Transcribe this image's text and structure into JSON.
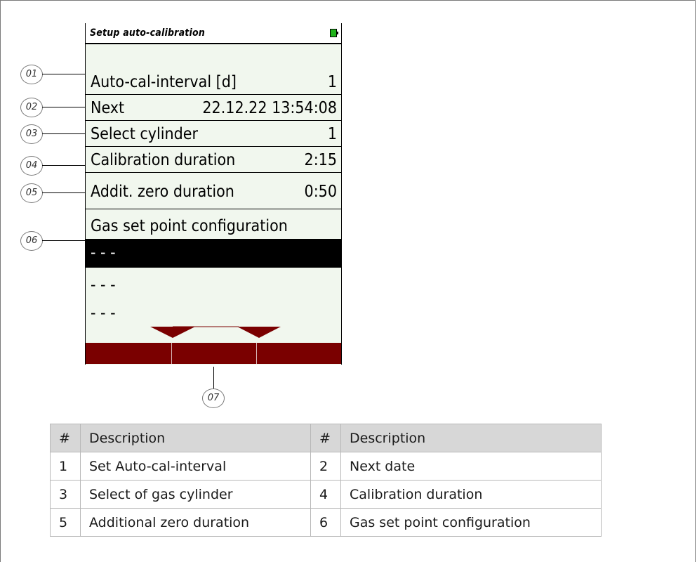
{
  "screen": {
    "title": "Setup auto-calibration",
    "rows": [
      {
        "label": "Auto-cal-interval [d]",
        "value": "1"
      },
      {
        "label": "Next",
        "value": "22.12.22 13:54:08"
      },
      {
        "label": "Select cylinder",
        "value": "1"
      },
      {
        "label": "Calibration duration",
        "value": "2:15"
      },
      {
        "label": "Addit. zero duration",
        "value": "0:50"
      }
    ],
    "gas_header": "Gas set point configuration",
    "gas_items": [
      "- - -",
      "- - -",
      "- - -"
    ],
    "colors": {
      "softkey_bar": "#7a0000",
      "battery": "#1fb21a",
      "screen_bg": "#f1f7ee"
    }
  },
  "callouts": [
    "01",
    "02",
    "03",
    "04",
    "05",
    "06",
    "07"
  ],
  "legend_table": {
    "headers": [
      "#",
      "Description",
      "#",
      "Description"
    ],
    "rows": [
      [
        "1",
        "Set Auto-cal-interval",
        "2",
        "Next date"
      ],
      [
        "3",
        "Select of gas cylinder",
        "4",
        "Calibration duration"
      ],
      [
        "5",
        "Additional zero duration",
        "6",
        "Gas set point configuration"
      ]
    ]
  }
}
